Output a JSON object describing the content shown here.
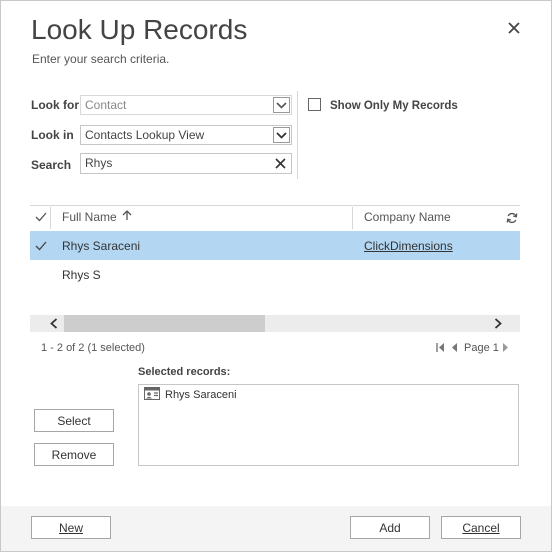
{
  "dialog": {
    "title": "Look Up Records",
    "subtitle": "Enter your search criteria.",
    "close_icon": "close-icon"
  },
  "criteria": {
    "look_for_label": "Look for",
    "look_for_value": "Contact",
    "look_in_label": "Look in",
    "look_in_value": "Contacts Lookup View",
    "search_label": "Search",
    "search_value": "Rhys",
    "show_only_mine_label": "Show Only My Records",
    "show_only_mine_checked": false
  },
  "grid": {
    "columns": [
      "Full Name",
      "Company Name"
    ],
    "sort_column": "Full Name",
    "sort_direction": "ascending",
    "rows": [
      {
        "selected": true,
        "full_name": "Rhys Saraceni",
        "company": "ClickDimensions"
      },
      {
        "selected": false,
        "full_name": "Rhys S",
        "company": ""
      }
    ],
    "refresh_icon": "refresh-icon"
  },
  "status": {
    "summary": "1 - 2 of 2 (1 selected)",
    "page_label": "Page 1"
  },
  "selected": {
    "label": "Selected records:",
    "items": [
      "Rhys Saraceni"
    ]
  },
  "buttons": {
    "select": "Select",
    "remove": "Remove",
    "new": "New",
    "add": "Add",
    "cancel": "Cancel"
  },
  "colors": {
    "selected_row": "#b3d6f2",
    "footer_bg": "#f4f4f4",
    "text": "#444444"
  }
}
